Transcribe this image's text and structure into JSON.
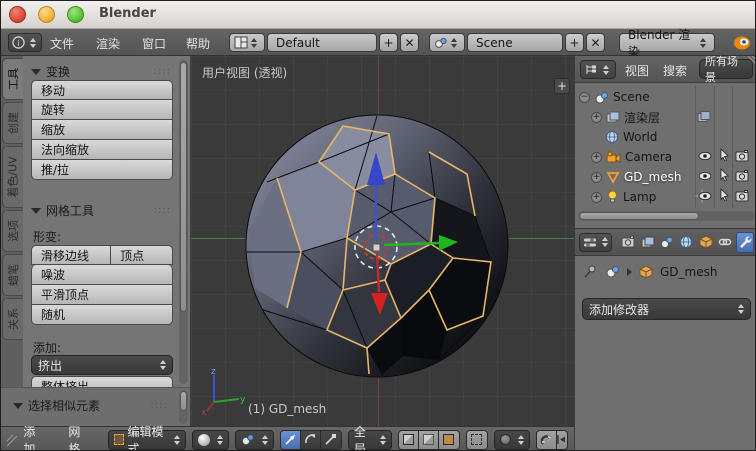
{
  "window": {
    "title": "Blender"
  },
  "topbar": {
    "menus": [
      "文件",
      "渲染",
      "窗口",
      "帮助"
    ],
    "layout": {
      "value": "Default",
      "add_label": "+",
      "close_label": "✕"
    },
    "scene": {
      "value": "Scene",
      "add_label": "+",
      "close_label": "✕"
    },
    "engine": {
      "value": "Blender 渲染"
    }
  },
  "toolshelf": {
    "tabs": [
      "工具",
      "创建",
      "着色/UV",
      "选项",
      "蜡笔",
      "关系"
    ],
    "active_tab": "工具",
    "transform": {
      "title": "变换",
      "buttons": [
        "移动",
        "旋转",
        "缩放",
        "法向缩放",
        "推/拉"
      ]
    },
    "mesh_tools": {
      "title": "网格工具",
      "deform_label": "形变:",
      "slide_row": [
        "滑移边线",
        "顶点"
      ],
      "buttons": [
        "噪波",
        "平滑顶点",
        "随机"
      ],
      "add_label": "添加:",
      "extrude_select": "挤出",
      "extrude_individual": "整体挤出"
    },
    "select_similar": {
      "title": "选择相似元素"
    }
  },
  "viewport": {
    "view_label": "用户视图 (透视)",
    "object_info": "(1) GD_mesh",
    "axis_labels": {
      "x": "x",
      "y": "y",
      "z": "z"
    }
  },
  "outliner": {
    "view_menu": "视图",
    "search_menu": "搜索",
    "display_filter": "所有场景",
    "rows": [
      {
        "label": "Scene"
      },
      {
        "label": "渲染层"
      },
      {
        "label": "World"
      },
      {
        "label": "Camera"
      },
      {
        "label": "GD_mesh"
      },
      {
        "label": "Lamp"
      }
    ]
  },
  "properties": {
    "tabs": [
      "render",
      "render-layers",
      "scene",
      "world",
      "object",
      "constraints",
      "modifiers"
    ],
    "active_tab": "modifiers",
    "breadcrumb_object": "GD_mesh",
    "add_modifier_label": "添加修改器"
  },
  "bottombar": {
    "add_menu": "添加",
    "mesh_menu": "网格",
    "mode": "编辑模式",
    "orientation": "全局"
  },
  "colors": {
    "selection_highlight": "#5680c2",
    "edge_select_orange": "#e9b568",
    "axis_x_red": "#d03c3c",
    "axis_y_green": "#2cb52c",
    "axis_z_blue": "#3c50d8",
    "object_orange": "#e8890c"
  }
}
